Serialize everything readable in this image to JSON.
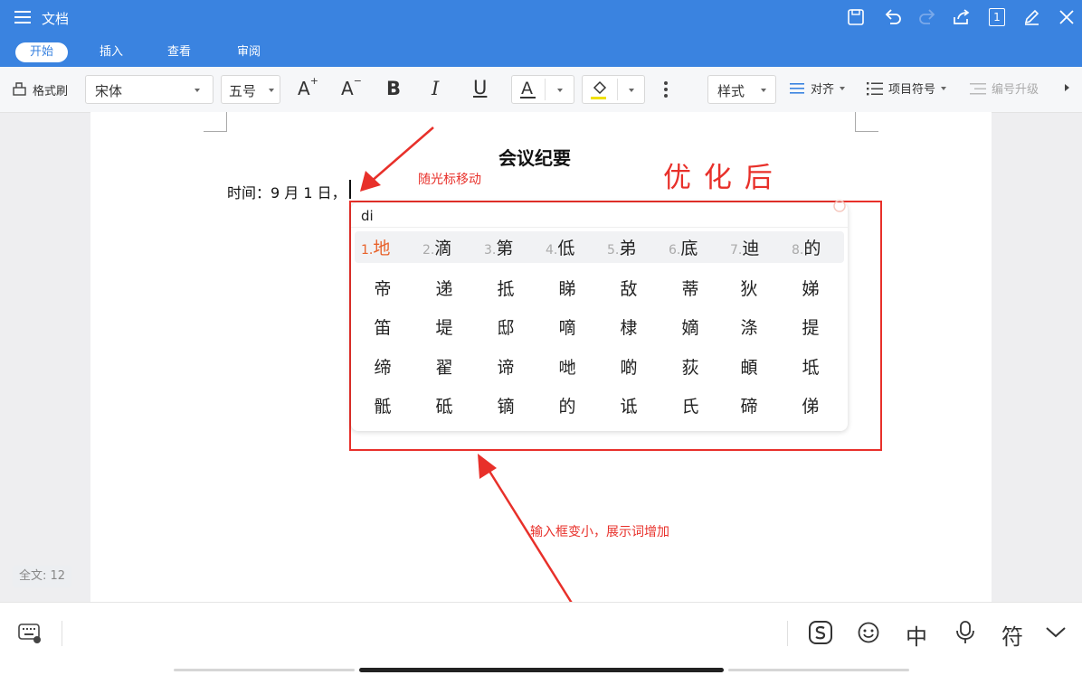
{
  "title_bar": {
    "menu_icon": "hamburger-icon",
    "title": "文档",
    "actions": [
      "save-icon",
      "undo-icon",
      "redo-icon",
      "share-icon",
      "page-count-icon",
      "edit-pen-icon",
      "close-icon"
    ],
    "page_count": "1"
  },
  "tabs": [
    {
      "label": "开始",
      "active": true
    },
    {
      "label": "插入",
      "active": false
    },
    {
      "label": "查看",
      "active": false
    },
    {
      "label": "审阅",
      "active": false
    }
  ],
  "toolbar": {
    "format_painter": "格式刷",
    "font_name": "宋体",
    "font_size": "五号",
    "increase_font": "A",
    "decrease_font": "A",
    "bold": "B",
    "italic": "I",
    "underline": "U",
    "font_color": "A",
    "style": "样式",
    "align": "对齐",
    "bullets": "项目符号",
    "numbering_upgrade": "编号升级"
  },
  "document": {
    "heading": "会议纪要",
    "line1": "时间：9 月 1 日，",
    "word_count": "全文: 12"
  },
  "ime": {
    "pinyin": "di",
    "candidates": [
      {
        "num": "1.",
        "char": "地"
      },
      {
        "num": "2.",
        "char": "滴"
      },
      {
        "num": "3.",
        "char": "第"
      },
      {
        "num": "4.",
        "char": "低"
      },
      {
        "num": "5.",
        "char": "弟"
      },
      {
        "num": "6.",
        "char": "底"
      },
      {
        "num": "7.",
        "char": "迪"
      },
      {
        "num": "8.",
        "char": "的"
      }
    ],
    "rows": [
      [
        "帝",
        "递",
        "抵",
        "睇",
        "敌",
        "蒂",
        "狄",
        "娣"
      ],
      [
        "笛",
        "堤",
        "邸",
        "嘀",
        "棣",
        "嫡",
        "涤",
        "提"
      ],
      [
        "缔",
        "翟",
        "谛",
        "哋",
        "啲",
        "荻",
        "頔",
        "坻"
      ],
      [
        "骶",
        "砥",
        "镝",
        "的",
        "诋",
        "氏",
        "碲",
        "俤"
      ]
    ]
  },
  "annotations": {
    "optimized": "优 化 后",
    "cursor_note": "随光标移动",
    "box_note": "输入框变小，展示词增加"
  },
  "keyboard_bar": {
    "left_icon": "keyboard-icon",
    "right_icons": [
      "sogou-icon",
      "emoji-icon",
      "chinese-mode-icon",
      "mic-icon",
      "symbol-icon",
      "collapse-chevron-icon"
    ],
    "chinese_label": "中",
    "symbol_label": "符"
  },
  "colors": {
    "brand_blue": "#3a83e0",
    "annotation_red": "#e8302a",
    "candidate_orange": "#e8622a"
  }
}
